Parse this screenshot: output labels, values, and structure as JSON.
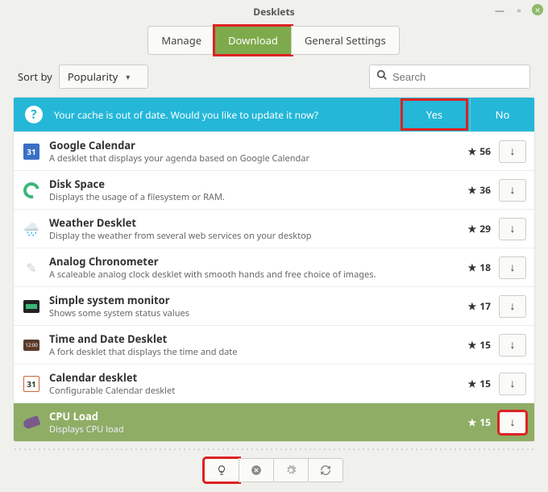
{
  "window": {
    "title": "Desklets"
  },
  "tabs": {
    "manage": "Manage",
    "download": "Download",
    "general": "General Settings"
  },
  "sort": {
    "label": "Sort by",
    "value": "Popularity"
  },
  "search": {
    "placeholder": "Search"
  },
  "banner": {
    "message": "Your cache is out of date. Would you like to update it now?",
    "yes": "Yes",
    "no": "No"
  },
  "items": [
    {
      "name": "Google Calendar",
      "desc": "A desklet that displays your agenda based on Google Calendar",
      "stars": 56,
      "day": "31"
    },
    {
      "name": "Disk Space",
      "desc": "Displays the usage of a filesystem or RAM.",
      "stars": 36
    },
    {
      "name": "Weather Desklet",
      "desc": "Display the weather from several web services on your desktop",
      "stars": 29
    },
    {
      "name": "Analog Chronometer",
      "desc": "A scaleable analog clock desklet with smooth hands and free choice of images.",
      "stars": 18
    },
    {
      "name": "Simple system monitor",
      "desc": "Shows some system status values",
      "stars": 17
    },
    {
      "name": "Time and Date Desklet",
      "desc": "A fork desklet that displays the time and date",
      "stars": 15
    },
    {
      "name": "Calendar desklet",
      "desc": "Configurable Calendar desklet",
      "stars": 15,
      "day": "31"
    },
    {
      "name": "CPU Load",
      "desc": "Displays CPU load",
      "stars": 15
    }
  ]
}
